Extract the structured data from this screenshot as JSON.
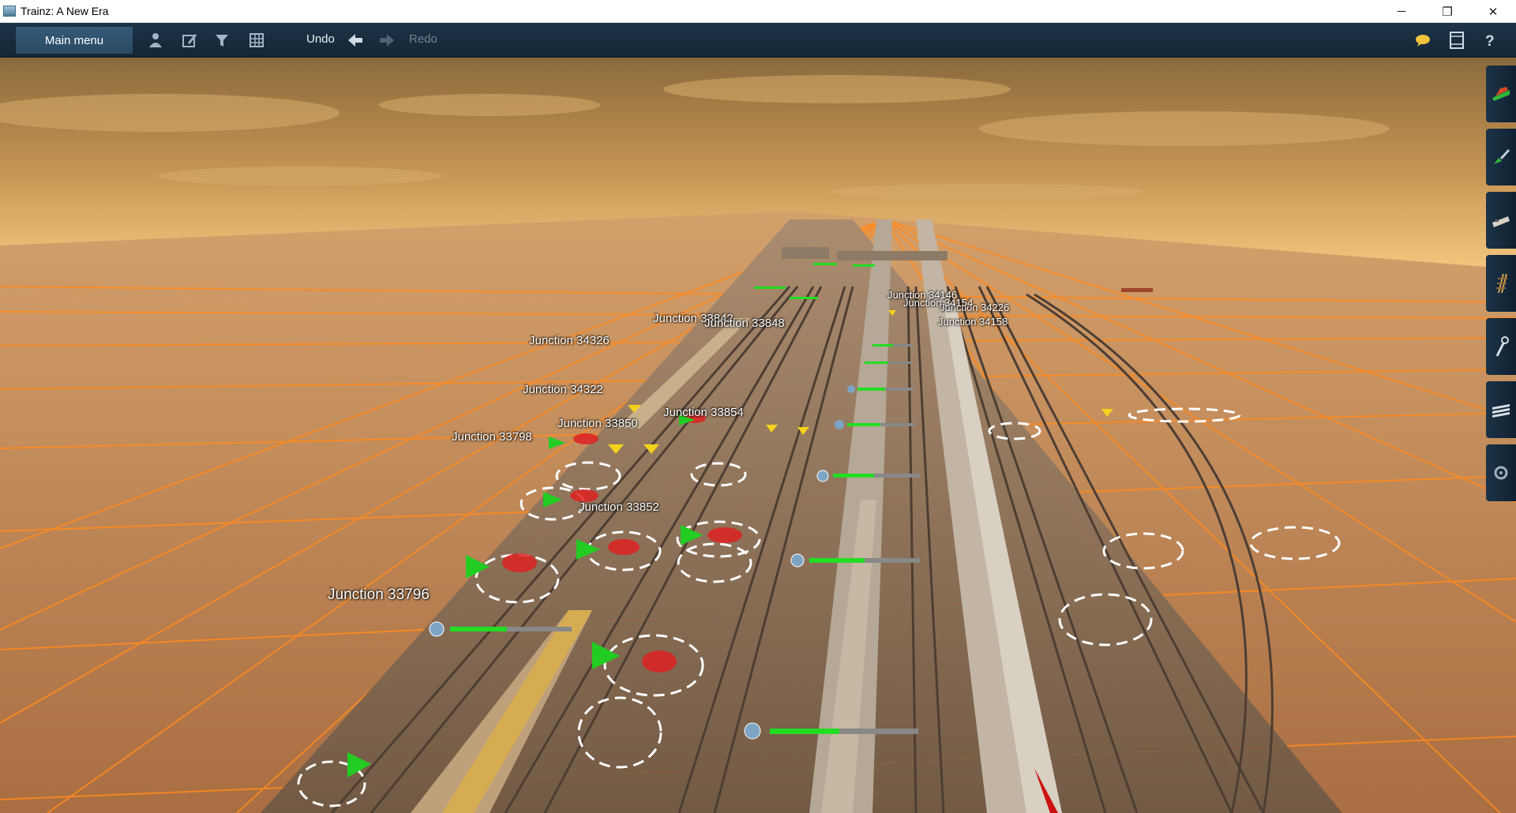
{
  "window": {
    "title": "Trainz: A New Era",
    "controls": {
      "minimize": "─",
      "maximize": "❐",
      "close": "✕"
    }
  },
  "toolbar": {
    "main_menu_label": "Main menu",
    "undo_label": "Undo",
    "redo_label": "Redo",
    "left_icons": [
      "driver-icon",
      "edit-icon",
      "filter-icon",
      "grid-icon"
    ],
    "right_icons": [
      "chat-icon",
      "film-icon",
      "help-icon"
    ]
  },
  "side_panel": {
    "tabs": [
      "train-tab-icon",
      "paint-tab-icon",
      "vehicle-tab-icon",
      "track-tab-icon",
      "tools-tab-icon",
      "layers-tab-icon",
      "settings-tab-icon"
    ]
  },
  "junctions": [
    {
      "label": "Junction 33842",
      "size": "normal"
    },
    {
      "label": "Junction 33848",
      "size": "normal"
    },
    {
      "label": "Junction 34326",
      "size": "normal"
    },
    {
      "label": "Junction 34322",
      "size": "normal"
    },
    {
      "label": "Junction 33854",
      "size": "normal"
    },
    {
      "label": "Junction 33850",
      "size": "normal"
    },
    {
      "label": "Junction 33798",
      "size": "normal"
    },
    {
      "label": "Junction 33852",
      "size": "normal"
    },
    {
      "label": "Junction 33796",
      "size": "big"
    },
    {
      "label": "Junction 34226",
      "size": "small"
    },
    {
      "label": "Junction 34158",
      "size": "small"
    },
    {
      "label": "Junction 34154",
      "size": "small"
    },
    {
      "label": "Junction 34146",
      "size": "small"
    }
  ],
  "colors": {
    "sky_top": "#8a6a3c",
    "sky_horizon": "#f0c27a",
    "ground": "#b87d4e",
    "grid_line": "#ff8a1e",
    "toolbar": "#1d3447",
    "signal_green": "#22cc22",
    "signal_red": "#dd2222",
    "marker_yellow": "#f2d21b"
  }
}
